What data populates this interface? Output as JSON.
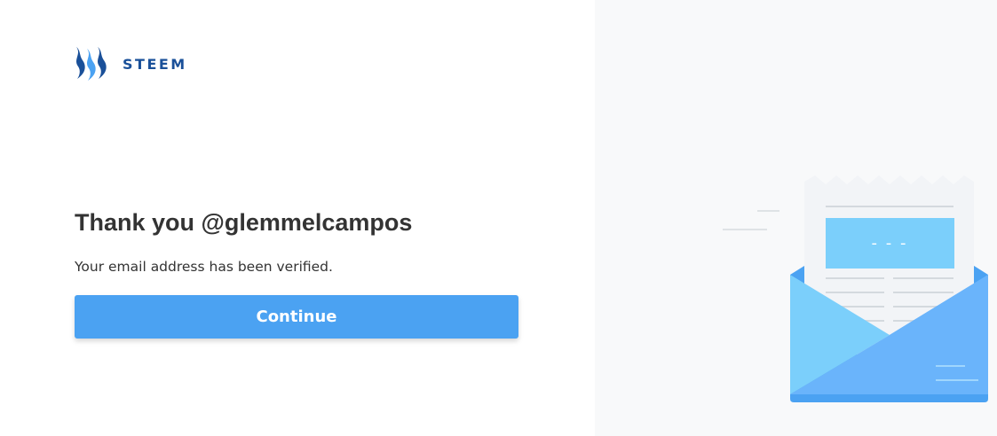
{
  "brand": {
    "name": "STEEM",
    "logo_icon": "steem-logo-icon",
    "color": "#1a5099"
  },
  "main": {
    "title": "Thank you @glemmelcampos",
    "message": "Your email address has been verified.",
    "continue_label": "Continue"
  },
  "illustration": {
    "icon": "open-envelope-with-letter-icon",
    "letter_dashes": "- - -"
  },
  "colors": {
    "accent": "#4ba2f2",
    "text": "#333333",
    "panel_background": "#f8f9fa",
    "envelope_light": "#7bcffb",
    "envelope_mid": "#6ab4fb",
    "envelope_dark": "#4ba2f2"
  }
}
